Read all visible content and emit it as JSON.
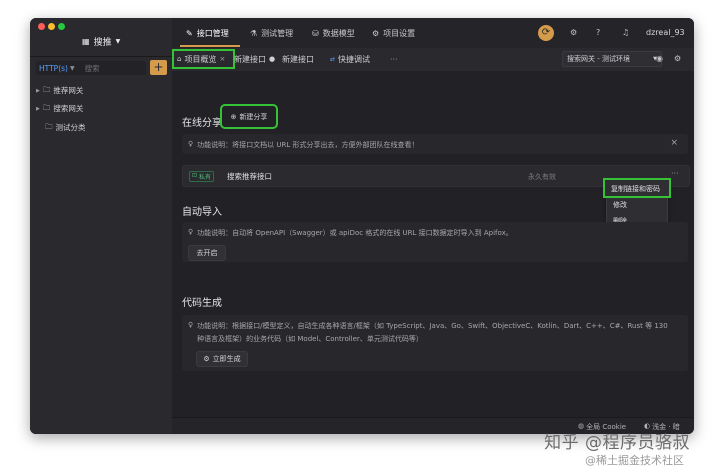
{
  "app": {
    "workspace_label": "搜推"
  },
  "topnav": {
    "items": [
      {
        "label": "接口管理",
        "icon": "pencil-icon",
        "active": true
      },
      {
        "label": "测试管理",
        "icon": "flask-icon",
        "active": false
      },
      {
        "label": "数据模型",
        "icon": "database-icon",
        "active": false
      },
      {
        "label": "项目设置",
        "icon": "gear-icon",
        "active": false
      }
    ],
    "username": "dzreal_93"
  },
  "sidebar": {
    "method_filter": "HTTP(s)",
    "search_placeholder": "搜索",
    "add_label": "+",
    "tree": [
      {
        "label": "推荐网关",
        "type": "folder",
        "expandable": true
      },
      {
        "label": "搜索网关",
        "type": "folder",
        "expandable": true
      },
      {
        "label": "测试分类",
        "type": "folder",
        "expandable": false
      }
    ]
  },
  "tabs": [
    {
      "label": "项目概览",
      "closable": true,
      "active": true
    },
    {
      "label": "新建接口",
      "dot": true
    },
    {
      "label": "新建接口"
    },
    {
      "label": "快捷调试",
      "icon": "http-icon"
    },
    {
      "label": "···"
    }
  ],
  "environment": {
    "selected": "搜索网关 - 测试环境"
  },
  "share": {
    "title": "在线分享",
    "new_button": "新建分享",
    "note": "功能说明：将接口文档以 URL 形式分享出去，方便外部团队在线查看！",
    "row": {
      "badge": "私有",
      "name": "搜索推荐接口",
      "expiry": "永久有效",
      "more": "···"
    },
    "menu": [
      "复制链接和密码",
      "修改",
      "删除"
    ]
  },
  "import": {
    "title": "自动导入",
    "note": "功能说明：自动将 OpenAPI（Swagger）或 apiDoc 格式的在线 URL 接口数据定时导入到 Apifox。",
    "button": "去开启"
  },
  "codegen": {
    "title": "代码生成",
    "note_line1": "功能说明：根据接口/模型定义，自动生成各种语言/框架（如 TypeScript、Java、Go、Swift、ObjectiveC、Kotlin、Dart、C++、C#、Rust 等 130",
    "note_line2": "种语言及框架）的业务代码（如 Model、Controller、单元测试代码等）",
    "button": "立即生成"
  },
  "statusbar": {
    "cookie": "全局 Cookie",
    "theme": "浅金 · 暗"
  },
  "watermark": {
    "line1": "知乎 @程序员骆叔",
    "line2": "@稀土掘金技术社区"
  },
  "colors": {
    "highlight": "#36c236",
    "accent": "#d49b4a",
    "window_bg": "#222226"
  }
}
